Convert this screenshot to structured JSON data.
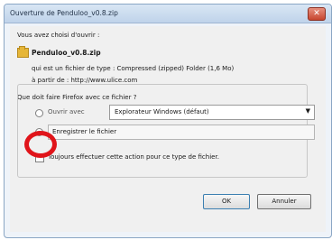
{
  "window": {
    "title": "Ouverture de Penduloo_v0.8.zip"
  },
  "dialog": {
    "intro": "Vous avez choisi d'ouvrir :",
    "file_name": "Penduloo_v0.8.zip",
    "type_line": "qui est un fichier de type : Compressed (zipped) Folder (1,6 Mo)",
    "from_line": "à partir de : http://www.ulice.com",
    "question": "Que doit faire Firefox avec ce fichier ?",
    "open_with_label": "Ouvrir avec",
    "open_with_value": "Explorateur Windows (défaut)",
    "save_label": "Enregistrer le fichier",
    "always_label": "Toujours effectuer cette action pour ce type de fichier.",
    "ok_label": "OK",
    "cancel_label": "Annuler"
  },
  "colors": {
    "highlight": "#e0141a",
    "close_button": "#c7452f"
  },
  "icons": [
    "close-icon",
    "zip-file-icon",
    "dropdown-arrow-icon"
  ]
}
